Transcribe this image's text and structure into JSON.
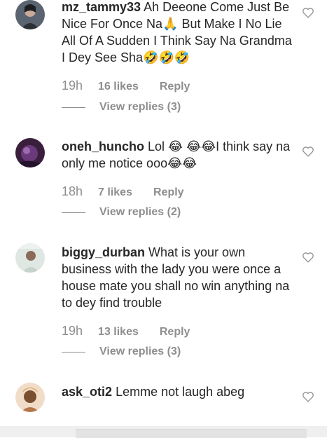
{
  "comments": [
    {
      "username": "mz_tammy33",
      "text": "Ah Deeone Come Just Be Nice For Once Na🙏 But Make I No Lie All Of A Sudden I Think Say Na Grandma I Dey See Sha🤣🤣🤣",
      "time": "19h",
      "likes": "16 likes",
      "reply": "Reply",
      "view_replies": "View replies (3)"
    },
    {
      "username": "oneh_huncho",
      "text": "Lol 😂 😂😂I think say na only me notice ooo😂😂",
      "time": "18h",
      "likes": "7 likes",
      "reply": "Reply",
      "view_replies": "View replies (2)"
    },
    {
      "username": "biggy_durban",
      "text": "What is your own business with the lady you were once a house mate you shall no win anything na to dey find trouble",
      "time": "19h",
      "likes": "13 likes",
      "reply": "Reply",
      "view_replies": "View replies (3)"
    },
    {
      "username": "ask_oti2",
      "text": "Lemme not laugh abeg"
    }
  ],
  "icons": {
    "like": "heart-outline-icon"
  },
  "colors": {
    "text": "#262626",
    "secondary": "#8e8e8e"
  }
}
